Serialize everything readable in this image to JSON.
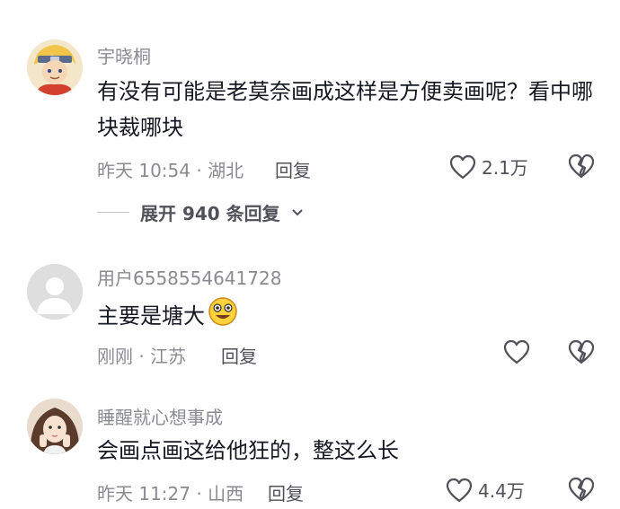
{
  "comments": [
    {
      "username": "宇晓桐",
      "text": "有没有可能是老莫奈画成这样是方便卖画呢？看中哪块裁哪块",
      "time_location": "昨天 10:54 · 湖北",
      "reply_label": "回复",
      "like_count": "2.1万",
      "expand_label": "展开 940 条回复"
    },
    {
      "username": "用户6558554641728",
      "text": "主要是塘大",
      "time_location": "刚刚 · 江苏",
      "reply_label": "回复",
      "like_count": ""
    },
    {
      "username": "睡醒就心想事成",
      "text": "会画点画这给他狂的，整这么长",
      "time_location": "昨天 11:27 · 山西",
      "reply_label": "回复",
      "like_count": "4.4万"
    }
  ],
  "colors": {
    "primary_text": "#161823",
    "secondary_text": "#8a8b91",
    "action_text": "#505159",
    "icon_stroke": "#505159"
  },
  "icons": [
    "heart-outline-icon",
    "broken-heart-icon",
    "chevron-down-icon",
    "smiling-emoji-icon"
  ]
}
